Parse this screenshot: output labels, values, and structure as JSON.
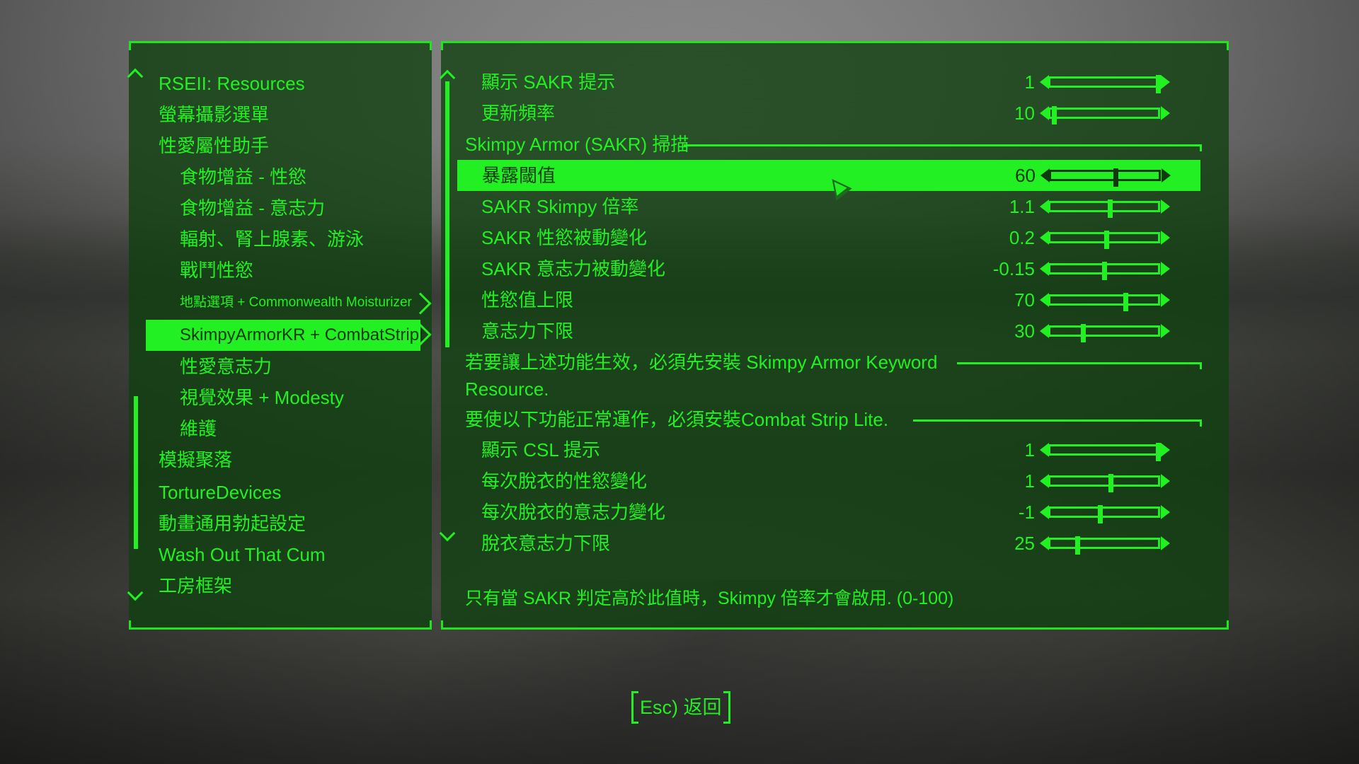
{
  "mod_list": {
    "items": [
      {
        "label": "RSEII: Resources",
        "indent": false
      },
      {
        "label": "螢幕攝影選單",
        "indent": false
      },
      {
        "label": "性愛屬性助手",
        "indent": false
      },
      {
        "label": "食物增益 - 性慾",
        "indent": true
      },
      {
        "label": "食物增益 - 意志力",
        "indent": true
      },
      {
        "label": "輻射、腎上腺素、游泳",
        "indent": true
      },
      {
        "label": "戰鬥性慾",
        "indent": true
      },
      {
        "label": "地點選項 + Commonwealth Moisturizer",
        "indent": true
      },
      {
        "label": "SkimpyArmorKR + CombatStripL",
        "indent": true
      },
      {
        "label": "性愛意志力",
        "indent": true
      },
      {
        "label": "視覺效果 + Modesty",
        "indent": true
      },
      {
        "label": "維護",
        "indent": true
      },
      {
        "label": "模擬聚落",
        "indent": false
      },
      {
        "label": "TortureDevices",
        "indent": false
      },
      {
        "label": "動畫通用勃起設定",
        "indent": false
      },
      {
        "label": "Wash Out That Cum",
        "indent": false
      },
      {
        "label": "工房框架",
        "indent": false
      }
    ],
    "selected_index": 8
  },
  "options": {
    "row0": {
      "label": "顯示 SAKR 提示",
      "value": "1",
      "fraction": 1.0
    },
    "row1": {
      "label": "更新頻率",
      "value": "10",
      "fraction": 0.03
    },
    "section1": "Skimpy Armor (SAKR) 掃描",
    "row2": {
      "label": "暴露閾值",
      "value": "60",
      "fraction": 0.6
    },
    "row3": {
      "label": "SAKR Skimpy 倍率",
      "value": "1.1",
      "fraction": 0.55
    },
    "row4": {
      "label": "SAKR 性慾被動變化",
      "value": "0.2",
      "fraction": 0.52
    },
    "row5": {
      "label": "SAKR 意志力被動變化",
      "value": "-0.15",
      "fraction": 0.5
    },
    "row6": {
      "label": "性慾值上限",
      "value": "70",
      "fraction": 0.7
    },
    "row7": {
      "label": "意志力下限",
      "value": "30",
      "fraction": 0.3
    },
    "section2_line1": "若要讓上述功能生效，必須先安裝 Skimpy Armor Keyword",
    "section2_line2": "Resource.",
    "section3": "要使以下功能正常運作，必須安裝Combat Strip Lite.",
    "row8": {
      "label": "顯示 CSL 提示",
      "value": "1",
      "fraction": 1.0
    },
    "row9": {
      "label": "每次脫衣的性慾變化",
      "value": "1",
      "fraction": 0.56
    },
    "row10": {
      "label": "每次脫衣的意志力變化",
      "value": "-1",
      "fraction": 0.46
    },
    "row11": {
      "label": "脫衣意志力下限",
      "value": "25",
      "fraction": 0.25
    }
  },
  "description": "只有當 SAKR 判定高於此值時，Skimpy 倍率才會啟用. (0-100)",
  "footer": {
    "back_label": "Esc) 返回"
  },
  "colors": {
    "accent": "#22f022",
    "panel_bg": "#104010",
    "selected_text": "#0e3a0e"
  }
}
